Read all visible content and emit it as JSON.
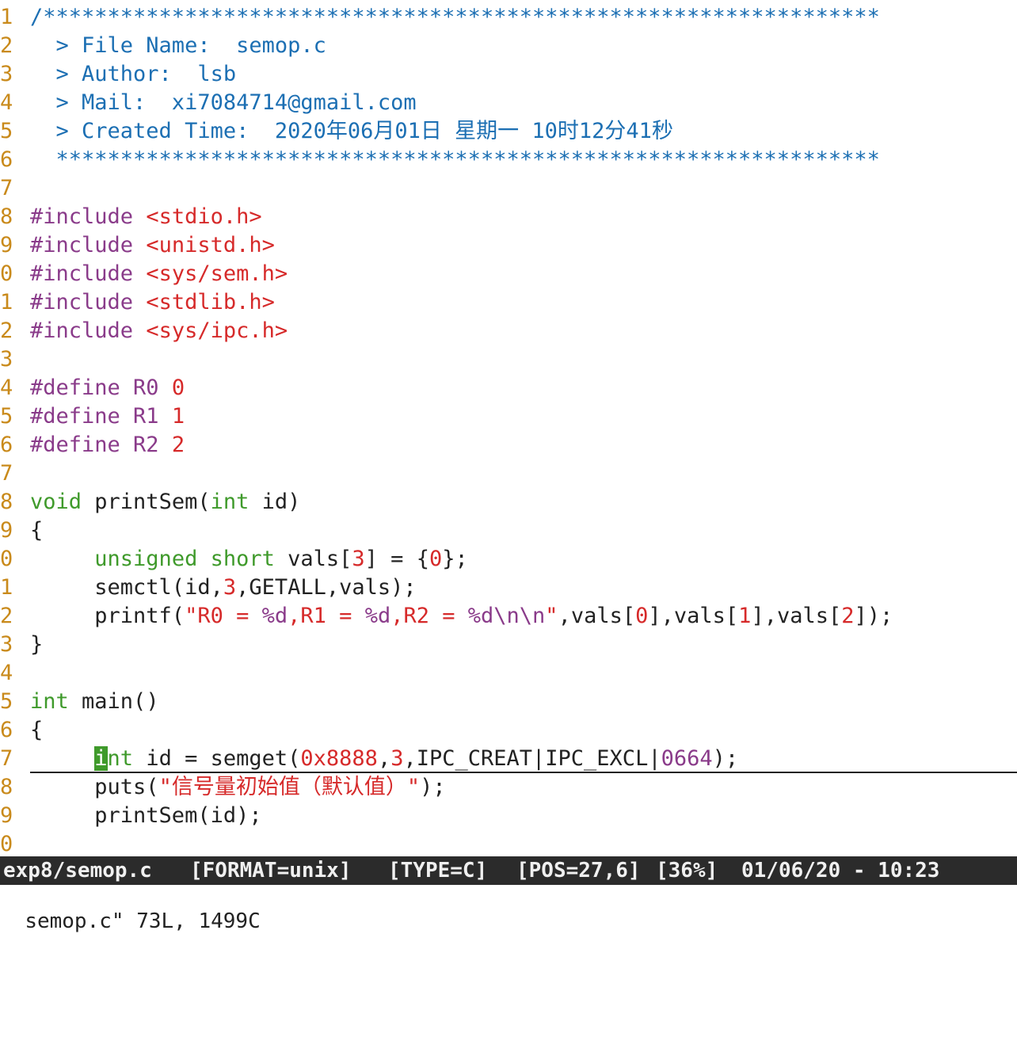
{
  "editor": {
    "lines": [
      {
        "n": "1",
        "parts": [
          [
            "c-blue",
            "/*****************************************************************"
          ]
        ]
      },
      {
        "n": "2",
        "parts": [
          [
            "c-blue",
            "  > File Name:  semop.c"
          ]
        ]
      },
      {
        "n": "3",
        "parts": [
          [
            "c-blue",
            "  > Author:  lsb"
          ]
        ]
      },
      {
        "n": "4",
        "parts": [
          [
            "c-blue",
            "  > Mail:  xi7084714@gmail.com"
          ]
        ]
      },
      {
        "n": "5",
        "parts": [
          [
            "c-blue",
            "  > Created Time:  2020年06月01日 星期一 10时12分41秒"
          ]
        ]
      },
      {
        "n": "6",
        "parts": [
          [
            "c-blue",
            "  ****************************************************************"
          ]
        ]
      },
      {
        "n": "7",
        "parts": []
      },
      {
        "n": "8",
        "parts": [
          [
            "c-purple",
            "#include "
          ],
          [
            "c-red",
            "<stdio.h>"
          ]
        ]
      },
      {
        "n": "9",
        "parts": [
          [
            "c-purple",
            "#include "
          ],
          [
            "c-red",
            "<unistd.h>"
          ]
        ]
      },
      {
        "n": "0",
        "parts": [
          [
            "c-purple",
            "#include "
          ],
          [
            "c-red",
            "<sys/sem.h>"
          ]
        ]
      },
      {
        "n": "1",
        "parts": [
          [
            "c-purple",
            "#include "
          ],
          [
            "c-red",
            "<stdlib.h>"
          ]
        ]
      },
      {
        "n": "2",
        "parts": [
          [
            "c-purple",
            "#include "
          ],
          [
            "c-red",
            "<sys/ipc.h>"
          ]
        ]
      },
      {
        "n": "3",
        "parts": []
      },
      {
        "n": "4",
        "parts": [
          [
            "c-purple",
            "#define R0 "
          ],
          [
            "c-red",
            "0"
          ]
        ]
      },
      {
        "n": "5",
        "parts": [
          [
            "c-purple",
            "#define R1 "
          ],
          [
            "c-red",
            "1"
          ]
        ]
      },
      {
        "n": "6",
        "parts": [
          [
            "c-purple",
            "#define R2 "
          ],
          [
            "c-red",
            "2"
          ]
        ]
      },
      {
        "n": "7",
        "parts": []
      },
      {
        "n": "8",
        "parts": [
          [
            "c-green",
            "void"
          ],
          [
            "c-dark",
            " printSem("
          ],
          [
            "c-green",
            "int"
          ],
          [
            "c-dark",
            " id)"
          ]
        ]
      },
      {
        "n": "9",
        "parts": [
          [
            "c-dark",
            "{"
          ]
        ]
      },
      {
        "n": "0",
        "parts": [
          [
            "c-dark",
            "     "
          ],
          [
            "c-green",
            "unsigned short"
          ],
          [
            "c-dark",
            " vals["
          ],
          [
            "c-red",
            "3"
          ],
          [
            "c-dark",
            "] = {"
          ],
          [
            "c-red",
            "0"
          ],
          [
            "c-dark",
            "};"
          ]
        ]
      },
      {
        "n": "1",
        "parts": [
          [
            "c-dark",
            "     semctl(id,"
          ],
          [
            "c-red",
            "3"
          ],
          [
            "c-dark",
            ",GETALL,vals);"
          ]
        ]
      },
      {
        "n": "2",
        "parts": [
          [
            "c-dark",
            "     printf("
          ],
          [
            "c-red",
            "\"R0 = "
          ],
          [
            "c-purple",
            "%d"
          ],
          [
            "c-red",
            ",R1 = "
          ],
          [
            "c-purple",
            "%d"
          ],
          [
            "c-red",
            ",R2 = "
          ],
          [
            "c-purple",
            "%d\\n\\n"
          ],
          [
            "c-red",
            "\""
          ],
          [
            "c-dark",
            ",vals["
          ],
          [
            "c-red",
            "0"
          ],
          [
            "c-dark",
            "],vals["
          ],
          [
            "c-red",
            "1"
          ],
          [
            "c-dark",
            "],vals["
          ],
          [
            "c-red",
            "2"
          ],
          [
            "c-dark",
            "]);"
          ]
        ]
      },
      {
        "n": "3",
        "parts": [
          [
            "c-dark",
            "}"
          ]
        ]
      },
      {
        "n": "4",
        "parts": []
      },
      {
        "n": "5",
        "parts": [
          [
            "c-green",
            "int"
          ],
          [
            "c-dark",
            " main()"
          ]
        ]
      },
      {
        "n": "6",
        "parts": [
          [
            "c-dark",
            "{"
          ]
        ]
      },
      {
        "n": "7",
        "cursorline": true,
        "parts": [
          [
            "c-dark",
            "     "
          ],
          [
            "cursor",
            "i"
          ],
          [
            "c-green",
            "nt"
          ],
          [
            "c-dark",
            " id = semget("
          ],
          [
            "c-red",
            "0x8888"
          ],
          [
            "c-dark",
            ","
          ],
          [
            "c-red",
            "3"
          ],
          [
            "c-dark",
            ",IPC_CREAT|IPC_EXCL|"
          ],
          [
            "c-purple",
            "0664"
          ],
          [
            "c-dark",
            ");"
          ]
        ]
      },
      {
        "n": "8",
        "parts": [
          [
            "c-dark",
            "     puts("
          ],
          [
            "c-red",
            "\"信号量初始值（默认值）\""
          ],
          [
            "c-dark",
            ");"
          ]
        ]
      },
      {
        "n": "9",
        "parts": [
          [
            "c-dark",
            "     printSem(id);"
          ]
        ]
      },
      {
        "n": "0",
        "parts": []
      }
    ]
  },
  "statusbar": {
    "file": "exp8/semop.c",
    "format": "[FORMAT=unix]",
    "type": "[TYPE=C]",
    "pos": "[POS=27,6]",
    "percent": "[36%]",
    "datetime": "01/06/20 - 10:23"
  },
  "cmdline": {
    "text": "semop.c\" 73L, 1499C"
  }
}
